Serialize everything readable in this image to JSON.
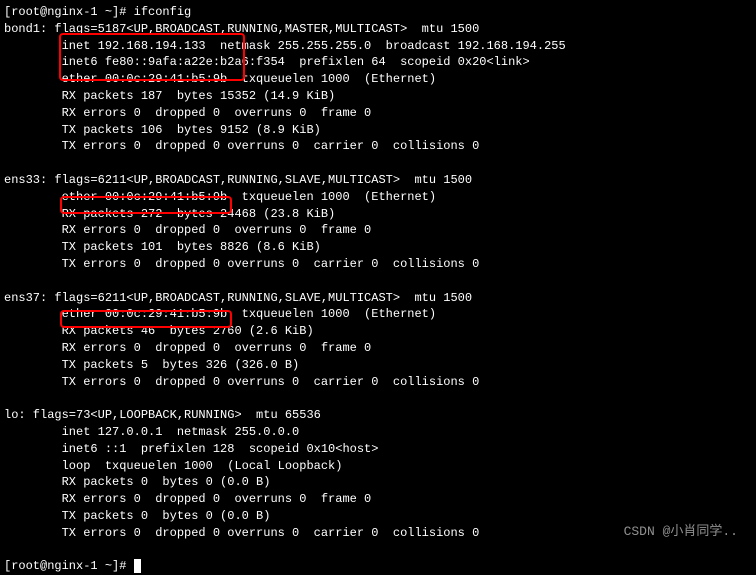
{
  "prompt1": "[root@nginx-1 ~]# ifconfig",
  "bond1": {
    "header": "bond1: flags=5187<UP,BROADCAST,RUNNING,MASTER,MULTICAST>  mtu 1500",
    "inet": "        inet 192.168.194.133  netmask 255.255.255.0  broadcast 192.168.194.255",
    "inet6": "        inet6 fe80::9afa:a22e:b2a6:f354  prefixlen 64  scopeid 0x20<link>",
    "ether": "        ether 00:0c:29:41:b5:9b  txqueuelen 1000  (Ethernet)",
    "rxp": "        RX packets 187  bytes 15352 (14.9 KiB)",
    "rxe": "        RX errors 0  dropped 0  overruns 0  frame 0",
    "txp": "        TX packets 106  bytes 9152 (8.9 KiB)",
    "txe": "        TX errors 0  dropped 0 overruns 0  carrier 0  collisions 0"
  },
  "ens33": {
    "header": "ens33: flags=6211<UP,BROADCAST,RUNNING,SLAVE,MULTICAST>  mtu 1500",
    "ether": "        ether 00:0c:29:41:b5:9b  txqueuelen 1000  (Ethernet)",
    "rxp": "        RX packets 272  bytes 24468 (23.8 KiB)",
    "rxe": "        RX errors 0  dropped 0  overruns 0  frame 0",
    "txp": "        TX packets 101  bytes 8826 (8.6 KiB)",
    "txe": "        TX errors 0  dropped 0 overruns 0  carrier 0  collisions 0"
  },
  "ens37": {
    "header": "ens37: flags=6211<UP,BROADCAST,RUNNING,SLAVE,MULTICAST>  mtu 1500",
    "ether": "        ether 00:0c:29:41:b5:9b  txqueuelen 1000  (Ethernet)",
    "rxp": "        RX packets 46  bytes 2760 (2.6 KiB)",
    "rxe": "        RX errors 0  dropped 0  overruns 0  frame 0",
    "txp": "        TX packets 5  bytes 326 (326.0 B)",
    "txe": "        TX errors 0  dropped 0 overruns 0  carrier 0  collisions 0"
  },
  "lo": {
    "header": "lo: flags=73<UP,LOOPBACK,RUNNING>  mtu 65536",
    "inet": "        inet 127.0.0.1  netmask 255.0.0.0",
    "inet6": "        inet6 ::1  prefixlen 128  scopeid 0x10<host>",
    "loop": "        loop  txqueuelen 1000  (Local Loopback)",
    "rxp": "        RX packets 0  bytes 0 (0.0 B)",
    "rxe": "        RX errors 0  dropped 0  overruns 0  frame 0",
    "txp": "        TX packets 0  bytes 0 (0.0 B)",
    "txe": "        TX errors 0  dropped 0 overruns 0  carrier 0  collisions 0"
  },
  "prompt2": "[root@nginx-1 ~]# ",
  "watermark": "CSDN @小肖同学.."
}
